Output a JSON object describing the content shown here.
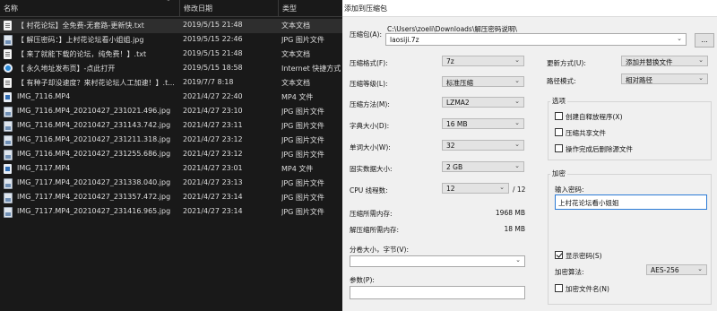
{
  "explorer": {
    "columns": {
      "name": "名称",
      "date": "修改日期",
      "type": "类型"
    },
    "files": [
      {
        "icon": "text-file-icon",
        "kind": "txt",
        "name": "【 村花论坛】全免费-无套路-更新快.txt",
        "date": "2019/5/15 21:48",
        "type": "文本文档"
      },
      {
        "icon": "jpg-file-icon",
        "kind": "jpg",
        "name": "【 解压密码：】上村花论坛看小姐姐.jpg",
        "date": "2019/5/15 22:46",
        "type": "JPG 图片文件"
      },
      {
        "icon": "text-file-icon",
        "kind": "txt",
        "name": "【 来了就能下载的论坛，纯免费！】.txt",
        "date": "2019/5/15 21:48",
        "type": "文本文档"
      },
      {
        "icon": "internet-shortcut-icon",
        "kind": "url",
        "name": "【 永久地址发布页】-点此打开",
        "date": "2019/5/15 18:58",
        "type": "Internet 快捷方式"
      },
      {
        "icon": "text-file-icon",
        "kind": "txt",
        "name": "【 有种子却没速度？来村花论坛人工加速！】.t...",
        "date": "2019/7/7 8:18",
        "type": "文本文档"
      },
      {
        "icon": "mp4-file-icon",
        "kind": "mp4",
        "name": "IMG_7116.MP4",
        "date": "2021/4/27 22:40",
        "type": "MP4 文件"
      },
      {
        "icon": "jpg-file-icon",
        "kind": "jpg",
        "name": "IMG_7116.MP4_20210427_231021.496.jpg",
        "date": "2021/4/27 23:10",
        "type": "JPG 图片文件"
      },
      {
        "icon": "jpg-file-icon",
        "kind": "jpg",
        "name": "IMG_7116.MP4_20210427_231143.742.jpg",
        "date": "2021/4/27 23:11",
        "type": "JPG 图片文件"
      },
      {
        "icon": "jpg-file-icon",
        "kind": "jpg",
        "name": "IMG_7116.MP4_20210427_231211.318.jpg",
        "date": "2021/4/27 23:12",
        "type": "JPG 图片文件"
      },
      {
        "icon": "jpg-file-icon",
        "kind": "jpg",
        "name": "IMG_7116.MP4_20210427_231255.686.jpg",
        "date": "2021/4/27 23:12",
        "type": "JPG 图片文件"
      },
      {
        "icon": "mp4-file-icon",
        "kind": "mp4",
        "name": "IMG_7117.MP4",
        "date": "2021/4/27 23:01",
        "type": "MP4 文件"
      },
      {
        "icon": "jpg-file-icon",
        "kind": "jpg",
        "name": "IMG_7117.MP4_20210427_231338.040.jpg",
        "date": "2021/4/27 23:13",
        "type": "JPG 图片文件"
      },
      {
        "icon": "jpg-file-icon",
        "kind": "jpg",
        "name": "IMG_7117.MP4_20210427_231357.472.jpg",
        "date": "2021/4/27 23:14",
        "type": "JPG 图片文件"
      },
      {
        "icon": "jpg-file-icon",
        "kind": "jpg",
        "name": "IMG_7117.MP4_20210427_231416.965.jpg",
        "date": "2021/4/27 23:14",
        "type": "JPG 图片文件"
      }
    ]
  },
  "dialog": {
    "title": "添加到压缩包",
    "archive": {
      "label": "压缩包(A):",
      "path": "C:\\Users\\zoeli\\Downloads\\解压密码说明\\",
      "value": "laosiji.7z",
      "browse": "..."
    },
    "format": {
      "label": "压缩格式(F):",
      "value": "7z"
    },
    "level": {
      "label": "压缩等级(L):",
      "value": "标准压缩"
    },
    "method": {
      "label": "压缩方法(M):",
      "value": "LZMA2"
    },
    "dict": {
      "label": "字典大小(D):",
      "value": "16 MB"
    },
    "word": {
      "label": "单词大小(W):",
      "value": "32"
    },
    "solid": {
      "label": "固实数据大小:",
      "value": "2 GB"
    },
    "cpu": {
      "label": "CPU 线程数:",
      "value": "12",
      "total": "/ 12"
    },
    "mem_compress": {
      "label": "压缩所需内存:",
      "value": "1968 MB"
    },
    "mem_decompress": {
      "label": "解压缩所需内存:",
      "value": "18 MB"
    },
    "split": {
      "label": "分卷大小，字节(V):",
      "value": ""
    },
    "params": {
      "label": "参数(P):",
      "value": ""
    },
    "update": {
      "label": "更新方式(U):",
      "value": "添加并替换文件"
    },
    "pathmode": {
      "label": "路径模式:",
      "value": "相对路径"
    },
    "options": {
      "title": "选项",
      "sfx": "创建自释放程序(X)",
      "shared": "压缩共享文件",
      "delete": "操作完成后删除源文件"
    },
    "encryption": {
      "title": "加密",
      "enter_label": "输入密码:",
      "password": "上村花论坛看小姐姐",
      "show_password": "显示密码(S)",
      "method_label": "加密算法:",
      "method_value": "AES-256",
      "encrypt_names": "加密文件名(N)"
    }
  }
}
